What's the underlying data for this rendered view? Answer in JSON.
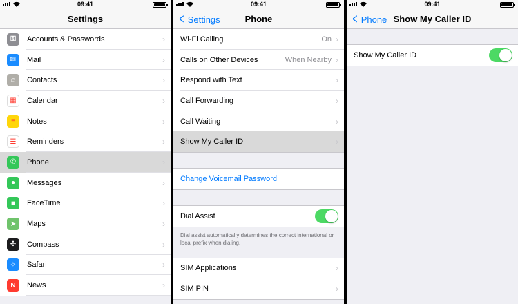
{
  "status_time": "09:41",
  "screen1": {
    "title": "Settings",
    "items": [
      {
        "label": "Accounts & Passwords",
        "icon": "key-icon",
        "color": "#8e8e93",
        "glyph": "⚿"
      },
      {
        "label": "Mail",
        "icon": "mail-icon",
        "color": "#1a8cff",
        "glyph": "✉"
      },
      {
        "label": "Contacts",
        "icon": "contacts-icon",
        "color": "#b0aea8",
        "glyph": "☺"
      },
      {
        "label": "Calendar",
        "icon": "calendar-icon",
        "color": "#ffffff",
        "glyph": "▦"
      },
      {
        "label": "Notes",
        "icon": "notes-icon",
        "color": "#ffd60a",
        "glyph": "≡"
      },
      {
        "label": "Reminders",
        "icon": "reminders-icon",
        "color": "#ffffff",
        "glyph": "☰"
      },
      {
        "label": "Phone",
        "icon": "phone-icon",
        "color": "#34c759",
        "glyph": "✆"
      },
      {
        "label": "Messages",
        "icon": "messages-icon",
        "color": "#34c759",
        "glyph": "●"
      },
      {
        "label": "FaceTime",
        "icon": "facetime-icon",
        "color": "#34c759",
        "glyph": "■"
      },
      {
        "label": "Maps",
        "icon": "maps-icon",
        "color": "#6fc36b",
        "glyph": "➤"
      },
      {
        "label": "Compass",
        "icon": "compass-icon",
        "color": "#1c1c1e",
        "glyph": "✣"
      },
      {
        "label": "Safari",
        "icon": "safari-icon",
        "color": "#1a8cff",
        "glyph": "✧"
      },
      {
        "label": "News",
        "icon": "news-icon",
        "color": "#ff3b30",
        "glyph": "N"
      }
    ],
    "selected": "Phone"
  },
  "screen2": {
    "back_label": "Settings",
    "title": "Phone",
    "group1": [
      {
        "label": "Wi-Fi Calling",
        "value": "On"
      },
      {
        "label": "Calls on Other Devices",
        "value": "When Nearby"
      },
      {
        "label": "Respond with Text",
        "value": ""
      },
      {
        "label": "Call Forwarding",
        "value": ""
      },
      {
        "label": "Call Waiting",
        "value": ""
      },
      {
        "label": "Show My Caller ID",
        "value": ""
      }
    ],
    "selected": "Show My Caller ID",
    "voicemail_label": "Change Voicemail Password",
    "dial_assist_label": "Dial Assist",
    "dial_assist_on": true,
    "dial_assist_footnote": "Dial assist automatically determines the correct international or local prefix when dialing.",
    "group4": [
      {
        "label": "SIM Applications"
      },
      {
        "label": "SIM PIN"
      }
    ]
  },
  "screen3": {
    "back_label": "Phone",
    "title": "Show My Caller ID",
    "row_label": "Show My Caller ID",
    "toggle_on": true
  },
  "colors": {
    "accent": "#007aff",
    "toggle_on": "#4cd964",
    "background": "#efeff4"
  }
}
